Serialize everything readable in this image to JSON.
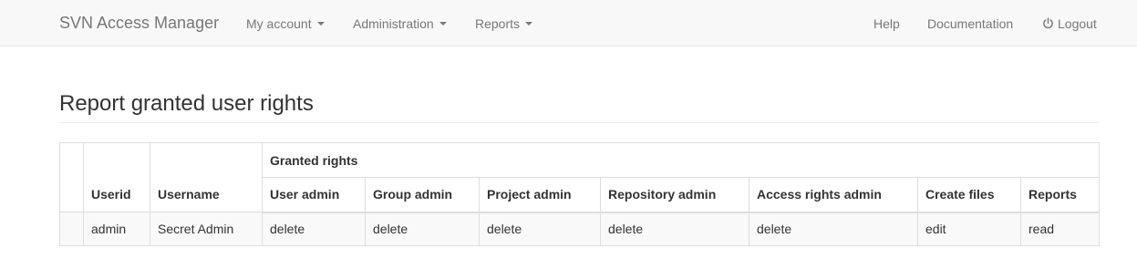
{
  "navbar": {
    "brand": "SVN Access Manager",
    "menus": [
      {
        "label": "My account"
      },
      {
        "label": "Administration"
      },
      {
        "label": "Reports"
      }
    ],
    "help": "Help",
    "documentation": "Documentation",
    "logout": "Logout",
    "logout_icon": "power-icon"
  },
  "page": {
    "title": "Report granted user rights"
  },
  "table": {
    "group_header": "Granted rights",
    "headers": {
      "userid": "Userid",
      "username": "Username",
      "user_admin": "User admin",
      "group_admin": "Group admin",
      "project_admin": "Project admin",
      "repository_admin": "Repository admin",
      "access_rights_admin": "Access rights admin",
      "create_files": "Create files",
      "reports": "Reports"
    },
    "rows": [
      {
        "userid": "admin",
        "username": "Secret Admin",
        "user_admin": "delete",
        "group_admin": "delete",
        "project_admin": "delete",
        "repository_admin": "delete",
        "access_rights_admin": "delete",
        "create_files": "edit",
        "reports": "read"
      }
    ]
  }
}
